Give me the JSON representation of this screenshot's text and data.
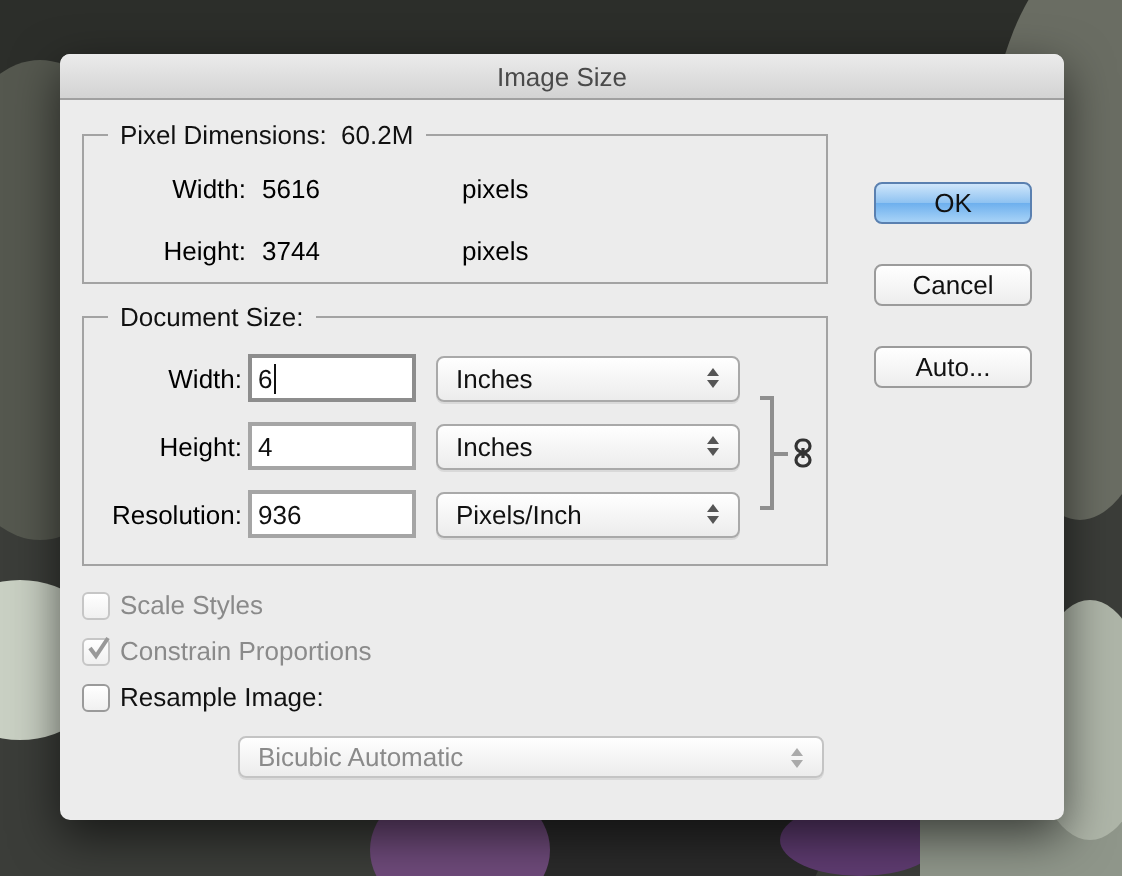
{
  "window": {
    "title": "Image Size"
  },
  "buttons": [
    {
      "label": "OK",
      "default": true
    },
    {
      "label": "Cancel",
      "default": false
    },
    {
      "label": "Auto...",
      "default": false
    }
  ],
  "pixel_dimensions": {
    "label": "Pixel Dimensions:",
    "value": "60.2M",
    "rows": [
      {
        "label": "Width:",
        "value": "5616",
        "unit": "pixels"
      },
      {
        "label": "Height:",
        "value": "3744",
        "unit": "pixels"
      }
    ]
  },
  "document_size": {
    "label": "Document Size:",
    "rows": [
      {
        "label": "Width:",
        "value": "6",
        "unit": "Inches",
        "focused": true
      },
      {
        "label": "Height:",
        "value": "4",
        "unit": "Inches",
        "focused": false
      },
      {
        "label": "Resolution:",
        "value": "936",
        "unit": "Pixels/Inch",
        "focused": false
      }
    ]
  },
  "checkboxes": [
    {
      "label": "Scale Styles",
      "checked": false,
      "disabled": true
    },
    {
      "label": "Constrain Proportions",
      "checked": true,
      "disabled": true
    },
    {
      "label": "Resample Image:",
      "checked": false,
      "disabled": false
    }
  ],
  "resample_method": {
    "value": "Bicubic Automatic",
    "disabled": true
  }
}
